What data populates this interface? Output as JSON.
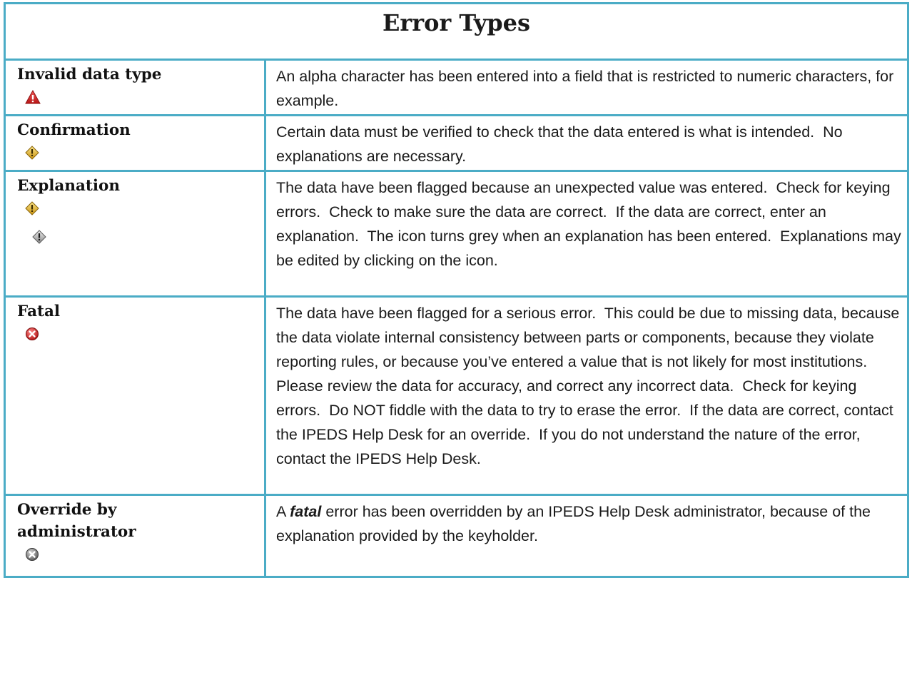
{
  "title": "Error Types",
  "colors": {
    "border": "#4bacc6",
    "invalid_icon": "#d32020",
    "warning_icon": "#e8c040",
    "grey_icon": "#9a9a9a",
    "fatal_icon": "#d32020"
  },
  "rows": [
    {
      "name": "Invalid data type",
      "icons": [
        "invalid-data-type-icon"
      ],
      "description": "An alpha character has been entered into a field that is restricted to numeric characters, for example."
    },
    {
      "name": "Confirmation",
      "icons": [
        "confirmation-warning-icon"
      ],
      "description": "Certain data must be verified to check that the data entered is what is intended.  No explanations are necessary."
    },
    {
      "name": "Explanation",
      "icons": [
        "explanation-warning-icon",
        "explanation-entered-grey-icon"
      ],
      "description": "The data have been flagged because an unexpected value was entered.  Check for keying errors.  Check to make sure the data are correct.  If the data are correct, enter an explanation.  The icon turns grey when an explanation has been entered.  Explanations may be edited by clicking on the icon."
    },
    {
      "name": "Fatal",
      "icons": [
        "fatal-error-icon"
      ],
      "description": "The data have been flagged for a serious error.  This could be due to missing data, because the data violate internal consistency between parts or components, because they violate reporting rules, or because you’ve entered a value that is not likely for most institutions.  Please review the data for accuracy, and correct any incorrect data.  Check for keying errors.  Do NOT fiddle with the data to try to erase the error.  If the data are correct, contact the IPEDS Help Desk for an override.  If you do not understand the nature of the error, contact the IPEDS Help Desk."
    },
    {
      "name": "Override by administrator",
      "icons": [
        "override-grey-icon"
      ],
      "description_prefix": "A ",
      "description_emphasis": "fatal",
      "description_rest": " error has been overridden by an IPEDS Help Desk administrator, because of the explanation provided by the keyholder."
    }
  ]
}
